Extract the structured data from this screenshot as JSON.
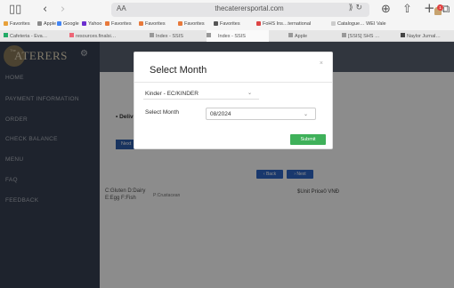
{
  "browser": {
    "sidebar_icon": "sidebar-icon",
    "back_glyph": "‹",
    "forward_glyph": "›",
    "aa_label": "AA",
    "lock_glyph": "🔒",
    "url": "thecaterersportal.com",
    "extensions_glyph": "⟫ ↻",
    "download_glyph": "⊕",
    "share_glyph": "⇧",
    "newtab_glyph": "+",
    "tabs_glyph": "⧉"
  },
  "favorites": [
    {
      "label": "Favorites",
      "color": "#e8a13b"
    },
    {
      "label": "Apple",
      "color": "#8a8a8a"
    },
    {
      "label": "Google",
      "color": "#4285f4"
    },
    {
      "label": "Yahoo",
      "color": "#6c2ecf"
    },
    {
      "label": "Favorites",
      "color": "#e8793b"
    },
    {
      "label": "Favorites",
      "color": "#e8793b"
    },
    {
      "label": "Favorites",
      "color": "#e8793b"
    },
    {
      "label": "Favorites",
      "color": "#555555"
    },
    {
      "label": "FoHS Ins…ternational",
      "color": "#d44"
    },
    {
      "label": "Catalogue… WEI Vale",
      "color": "#ccc"
    }
  ],
  "tabs": [
    {
      "label": "Cafeteria - Eva…",
      "color": "#2a6"
    },
    {
      "label": "resources.finalsi…",
      "color": "#e67"
    },
    {
      "label": "Index - SSIS",
      "color": "#999"
    },
    {
      "label": "Index - SSIS",
      "color": "#999",
      "active": true
    },
    {
      "label": "Apple",
      "color": "#999"
    },
    {
      "label": "[SSIS] SHS …",
      "color": "#999"
    },
    {
      "label": "Naylor Jurnal…",
      "color": "#444"
    }
  ],
  "sidebar": {
    "logo_text": "ATERERS",
    "logo_small": "The",
    "items": [
      {
        "label": "HOME"
      },
      {
        "label": "PAYMENT INFORMATION"
      },
      {
        "label": "ORDER"
      },
      {
        "label": "CHECK BALANCE"
      },
      {
        "label": "MENU"
      },
      {
        "label": "FAQ"
      },
      {
        "label": "FEEDBACK"
      }
    ]
  },
  "header": {
    "notification_count": "1"
  },
  "content": {
    "deliver_label": "• Deliver",
    "blue_button_label": "Next",
    "back_label": "‹ Back",
    "next_label": "› Next",
    "info_line1": "C:Gluten D:Dairy",
    "info_line2": "E:Egg   F:Fish",
    "info_line3": "P:Crustacean",
    "unit_price": "$Unit Price0 VNĐ"
  },
  "modal": {
    "title": "Select Month",
    "close_glyph": "×",
    "student_select": "Kinder - EC/KINDER",
    "month_label": "Select Month",
    "month_value": "08/2024",
    "submit_label": "Submit",
    "chevron": "⌄"
  }
}
